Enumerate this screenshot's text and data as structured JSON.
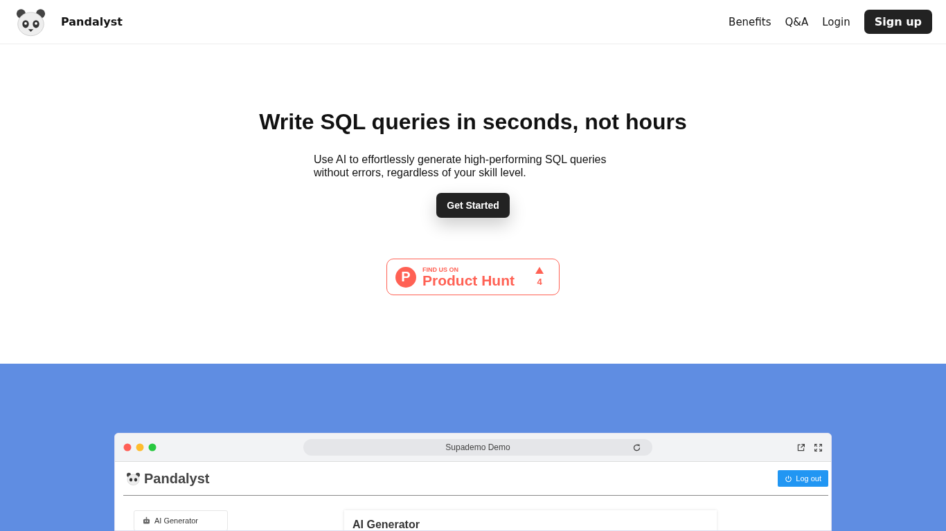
{
  "header": {
    "brand": "Pandalyst",
    "nav": [
      "Benefits",
      "Q&A",
      "Login"
    ],
    "signup": "Sign up"
  },
  "hero": {
    "title": "Write SQL queries in seconds, not hours",
    "subtitle": "Use AI to effortlessly generate high-performing SQL queries without errors, regardless of your skill level.",
    "cta": "Get Started"
  },
  "product_hunt": {
    "eyebrow": "FIND US ON",
    "name": "Product Hunt",
    "letter": "P",
    "votes": "4"
  },
  "demo": {
    "address": "Supademo Demo",
    "app_brand": "Pandalyst",
    "logout": "Log out",
    "sidebar_items": [
      "AI Generator"
    ],
    "panel_title": "AI Generator"
  }
}
